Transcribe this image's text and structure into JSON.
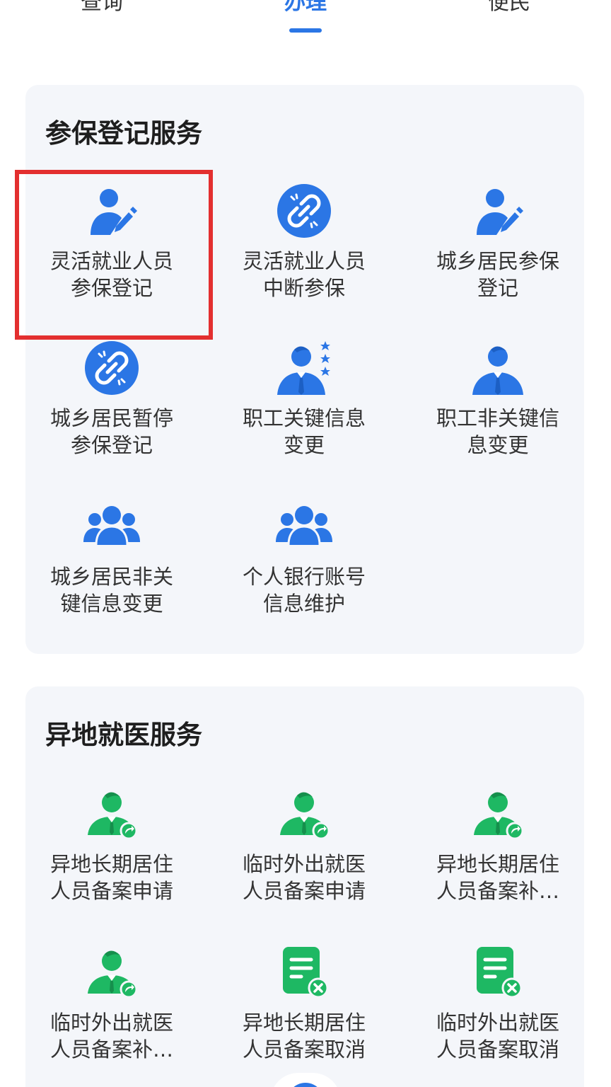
{
  "tabs": [
    {
      "label": "查询",
      "active": false
    },
    {
      "label": "办理",
      "active": true
    },
    {
      "label": "便民",
      "active": false
    }
  ],
  "colors": {
    "accent": "#2b76e5",
    "green": "#1eb863",
    "highlight": "#e32f2f",
    "card_bg": "#f4f6fa"
  },
  "sections": [
    {
      "title": "参保登记服务",
      "items": [
        {
          "icon": "person-pen-icon",
          "label": "灵活就业人员\n参保登记",
          "highlighted": true
        },
        {
          "icon": "broken-link-icon",
          "label": "灵活就业人员\n中断参保"
        },
        {
          "icon": "person-pen-icon",
          "label": "城乡居民参保\n登记"
        },
        {
          "icon": "broken-link-icon",
          "label": "城乡居民暂停\n参保登记"
        },
        {
          "icon": "person-stars-icon",
          "label": "职工关键信息\n变更"
        },
        {
          "icon": "person-tie-icon",
          "label": "职工非关键信\n息变更"
        },
        {
          "icon": "group-icon",
          "label": "城乡居民非关\n键信息变更"
        },
        {
          "icon": "group-icon",
          "label": "个人银行账号\n信息维护"
        }
      ]
    },
    {
      "title": "异地就医服务",
      "items": [
        {
          "icon": "person-share-icon",
          "label": "异地长期居住\n人员备案申请"
        },
        {
          "icon": "person-share-icon",
          "label": "临时外出就医\n人员备案申请"
        },
        {
          "icon": "person-share-icon",
          "label": "异地长期居住\n人员备案补…"
        },
        {
          "icon": "person-share-icon",
          "label": "临时外出就医\n人员备案补…"
        },
        {
          "icon": "doc-cancel-icon",
          "label": "异地长期居住\n人员备案取消"
        },
        {
          "icon": "doc-cancel-icon",
          "label": "临时外出就医\n人员备案取消"
        }
      ]
    }
  ]
}
